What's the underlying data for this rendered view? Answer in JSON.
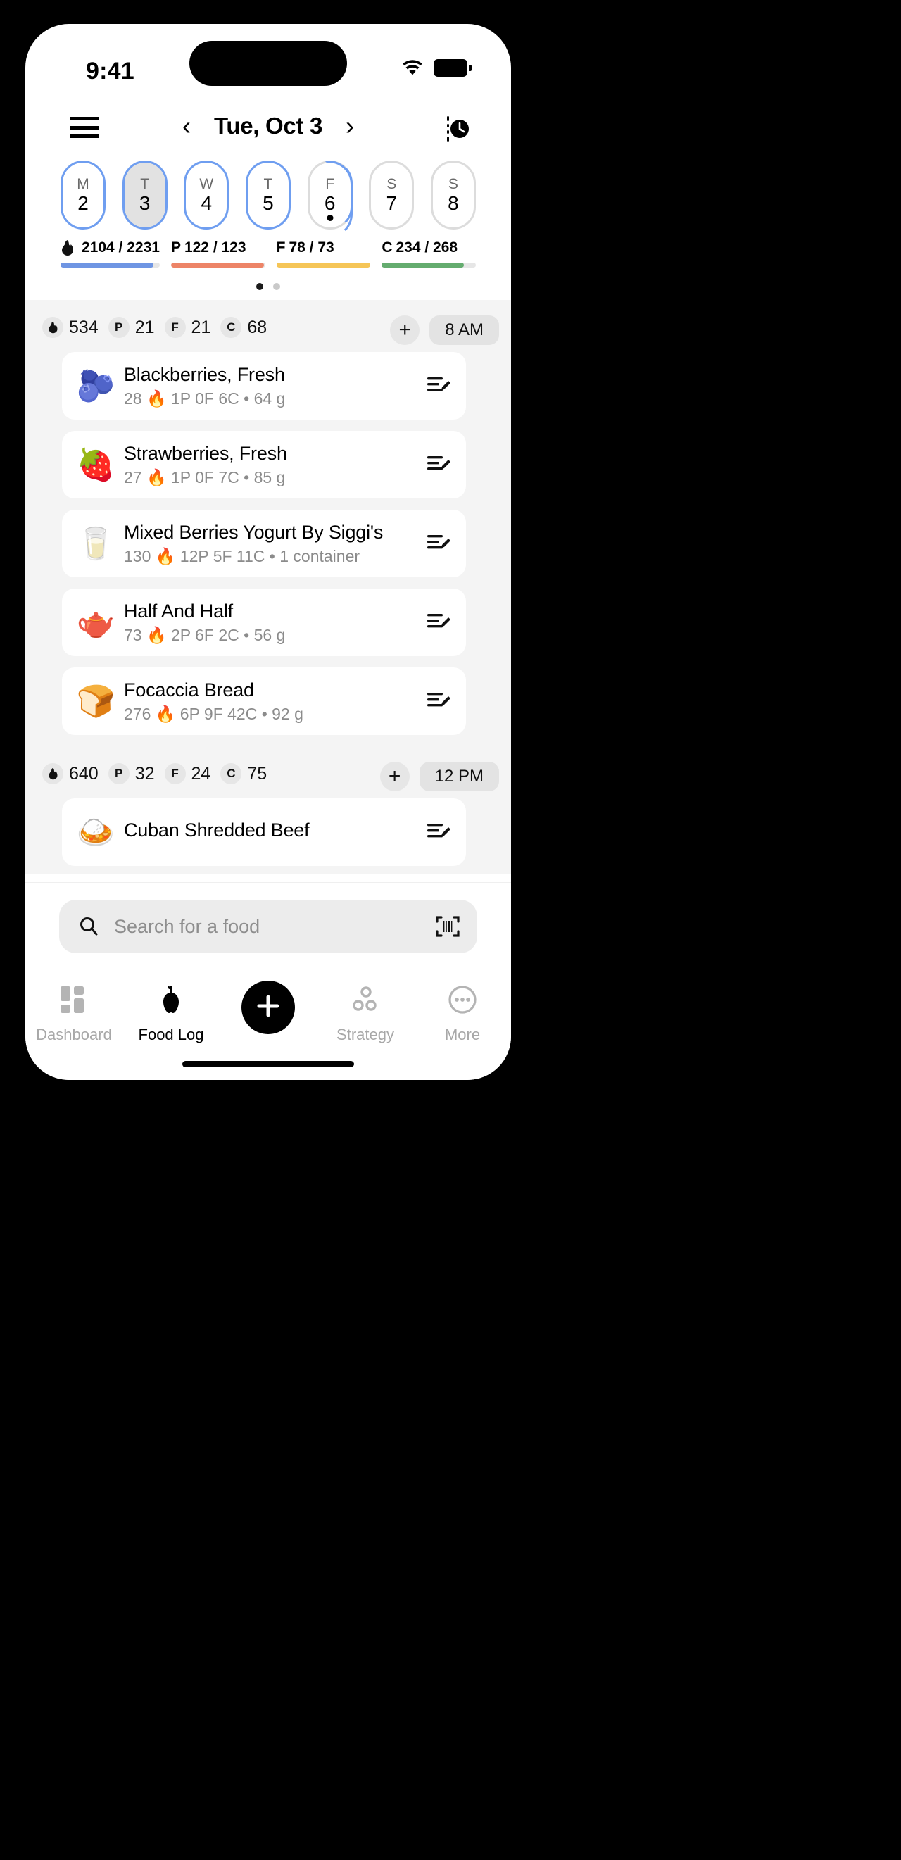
{
  "status_bar": {
    "time": "9:41",
    "wifi_icon": "wifi-icon",
    "battery_icon": "battery-icon"
  },
  "header": {
    "menu_icon": "hamburger-menu-icon",
    "prev_label": "‹",
    "date": "Tue, Oct 3",
    "next_label": "›",
    "fasting_icon": "fasting-clock-icon"
  },
  "week": {
    "days": [
      {
        "letter": "M",
        "date": "2",
        "ring": "full",
        "selected": false,
        "dot": false
      },
      {
        "letter": "T",
        "date": "3",
        "ring": "full",
        "selected": true,
        "dot": false
      },
      {
        "letter": "W",
        "date": "4",
        "ring": "full",
        "selected": false,
        "dot": false
      },
      {
        "letter": "T",
        "date": "5",
        "ring": "full",
        "selected": false,
        "dot": false
      },
      {
        "letter": "F",
        "date": "6",
        "ring": "half",
        "selected": false,
        "dot": true
      },
      {
        "letter": "S",
        "date": "7",
        "ring": "none",
        "selected": false,
        "dot": false
      },
      {
        "letter": "S",
        "date": "8",
        "ring": "none",
        "selected": false,
        "dot": false
      }
    ]
  },
  "macros": {
    "items": [
      {
        "key": "calories",
        "prefix": "",
        "icon": "flame-icon",
        "text": "2104 / 2231",
        "consumed": 2104,
        "goal": 2231,
        "percent": 94,
        "color": "#6f95e3"
      },
      {
        "key": "protein",
        "prefix": "P",
        "icon": "",
        "text": "122 / 123",
        "consumed": 122,
        "goal": 123,
        "percent": 99,
        "color": "#ed8467"
      },
      {
        "key": "fat",
        "prefix": "F",
        "icon": "",
        "text": "78 / 73",
        "consumed": 78,
        "goal": 73,
        "percent": 100,
        "color": "#f5c557"
      },
      {
        "key": "carbs",
        "prefix": "C",
        "icon": "",
        "text": "234 / 268",
        "consumed": 234,
        "goal": 268,
        "percent": 87,
        "color": "#64ac6f"
      }
    ]
  },
  "page_dots": {
    "count": 2,
    "active_index": 0
  },
  "meals": [
    {
      "time": "8 AM",
      "add_label": "+",
      "totals": [
        {
          "chip": "flame-icon",
          "value": "534"
        },
        {
          "chip": "P",
          "value": "21"
        },
        {
          "chip": "F",
          "value": "21"
        },
        {
          "chip": "C",
          "value": "68"
        }
      ],
      "foods": [
        {
          "emoji": "🫐",
          "name": "Blackberries, Fresh",
          "calories": "28",
          "protein": "1P",
          "fat": "0F",
          "carbs": "6C",
          "serving": "64 g",
          "macros": "28 🔥 1P  0F  6C • 64 g"
        },
        {
          "emoji": "🍓",
          "name": "Strawberries, Fresh",
          "calories": "27",
          "protein": "1P",
          "fat": "0F",
          "carbs": "7C",
          "serving": "85 g",
          "macros": "27 🔥 1P  0F  7C • 85 g"
        },
        {
          "emoji": "🥛",
          "name": "Mixed Berries Yogurt By Siggi's",
          "calories": "130",
          "protein": "12P",
          "fat": "5F",
          "carbs": "11C",
          "serving": "1 container",
          "macros": "130 🔥 12P  5F  11C • 1 container"
        },
        {
          "emoji": "🫖",
          "name": "Half And Half",
          "calories": "73",
          "protein": "2P",
          "fat": "6F",
          "carbs": "2C",
          "serving": "56 g",
          "macros": "73 🔥 2P  6F  2C • 56 g"
        },
        {
          "emoji": "🍞",
          "name": "Focaccia Bread",
          "calories": "276",
          "protein": "6P",
          "fat": "9F",
          "carbs": "42C",
          "serving": "92 g",
          "macros": "276 🔥 6P  9F  42C • 92 g"
        }
      ]
    },
    {
      "time": "12 PM",
      "add_label": "+",
      "totals": [
        {
          "chip": "flame-icon",
          "value": "640"
        },
        {
          "chip": "P",
          "value": "32"
        },
        {
          "chip": "F",
          "value": "24"
        },
        {
          "chip": "C",
          "value": "75"
        }
      ],
      "foods": [
        {
          "emoji": "🍛",
          "name": "Cuban Shredded Beef",
          "macros": ""
        }
      ]
    }
  ],
  "search": {
    "placeholder": "Search for a food",
    "value": "",
    "search_icon": "search-icon",
    "barcode_icon": "barcode-scanner-icon"
  },
  "tabbar": {
    "items": [
      {
        "label": "Dashboard",
        "icon": "dashboard-grid-icon",
        "active": false
      },
      {
        "label": "Food Log",
        "icon": "apple-icon",
        "active": true
      },
      {
        "label": "",
        "icon": "plus-icon",
        "active": false
      },
      {
        "label": "Strategy",
        "icon": "strategy-circles-icon",
        "active": false
      },
      {
        "label": "More",
        "icon": "more-ellipsis-icon",
        "active": false
      }
    ]
  }
}
